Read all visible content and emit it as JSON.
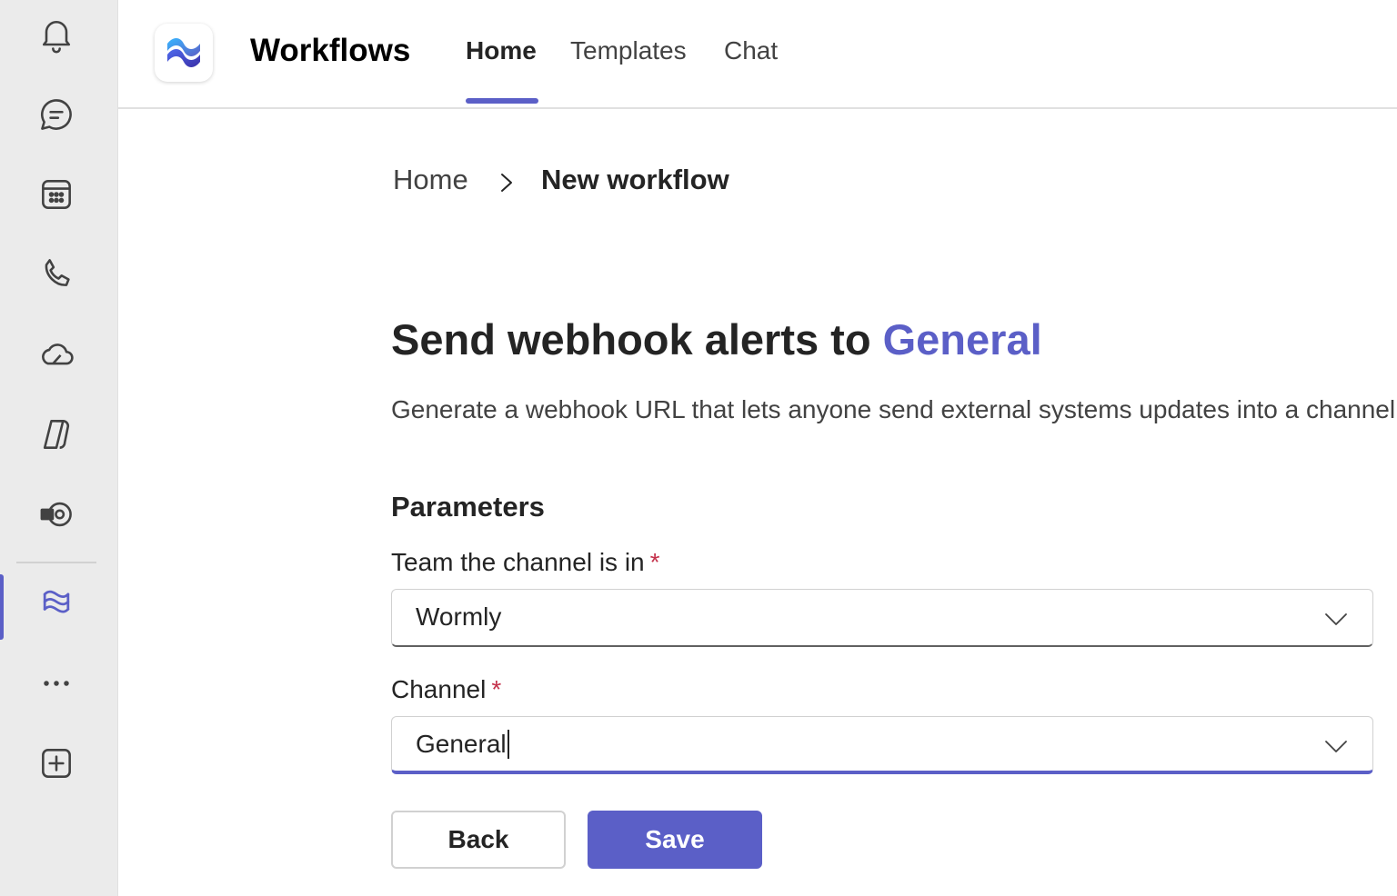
{
  "rail": {
    "icons": [
      "bell-icon",
      "chat-icon",
      "calendar-icon",
      "phone-icon",
      "onedrive-icon",
      "copilot-icon",
      "apps-settings-icon",
      "workflows-icon",
      "more-icon",
      "add-app-icon"
    ],
    "active": "workflows-icon"
  },
  "header": {
    "app_title": "Workflows",
    "tabs": [
      {
        "label": "Home",
        "active": true
      },
      {
        "label": "Templates",
        "active": false
      },
      {
        "label": "Chat",
        "active": false
      }
    ]
  },
  "breadcrumb": {
    "home": "Home",
    "current": "New workflow"
  },
  "main": {
    "title_prefix": "Send webhook alerts to",
    "title_accent": "General",
    "description": "Generate a webhook URL that lets anyone send external systems updates into a channel",
    "section_heading": "Parameters",
    "fields": [
      {
        "label": "Team the channel is in",
        "required_mark": "*",
        "value": "Wormly"
      },
      {
        "label": "Channel",
        "required_mark": "*",
        "value": "General"
      }
    ],
    "back_label": "Back",
    "save_label": "Save"
  },
  "colors": {
    "accent": "#5b5fc7",
    "required": "#c4314b",
    "rail_background": "#ebebeb"
  }
}
